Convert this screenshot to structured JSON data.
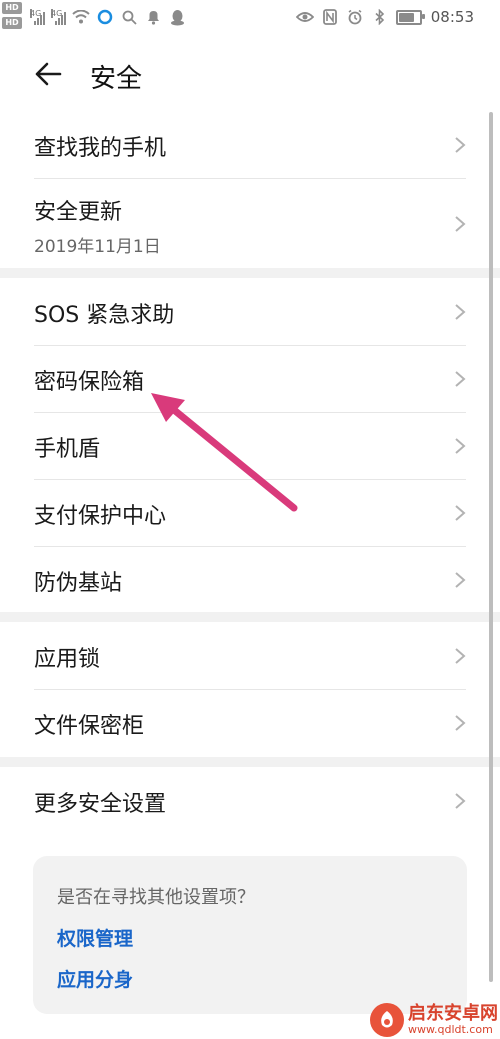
{
  "status_bar": {
    "hd_top": "HD",
    "hd_bottom": "HD",
    "network_1": "4G",
    "network_2": "4G",
    "time": "08:53",
    "battery_level": 0.85,
    "left_icons": [
      "hd-icon",
      "signal-icon",
      "signal-icon",
      "wifi-icon",
      "sync-icon",
      "search-icon",
      "notification-bell-icon",
      "qq-icon"
    ],
    "right_icons": [
      "eye-icon",
      "nfc-icon",
      "alarm-icon",
      "bluetooth-icon",
      "battery-icon"
    ]
  },
  "header": {
    "title": "安全",
    "back_icon": "arrow-left-icon"
  },
  "groups": [
    {
      "items": [
        {
          "label": "查找我的手机",
          "sub": ""
        },
        {
          "label": "安全更新",
          "sub": "2019年11月1日"
        }
      ]
    },
    {
      "items": [
        {
          "label": "SOS 紧急求助"
        },
        {
          "label": "密码保险箱"
        },
        {
          "label": "手机盾"
        },
        {
          "label": "支付保护中心"
        },
        {
          "label": "防伪基站"
        }
      ]
    },
    {
      "items": [
        {
          "label": "应用锁"
        },
        {
          "label": "文件保密柜"
        }
      ]
    },
    {
      "items": [
        {
          "label": "更多安全设置"
        }
      ]
    }
  ],
  "suggestion": {
    "question": "是否在寻找其他设置项？",
    "links": [
      "权限管理",
      "应用分身"
    ]
  },
  "watermark": {
    "title": "启东安卓网",
    "url": "www.qdldt.com"
  },
  "colors": {
    "link": "#1a66c9",
    "annotation_arrow": "#d93a7b",
    "section_gap": "#f1f1f1"
  }
}
